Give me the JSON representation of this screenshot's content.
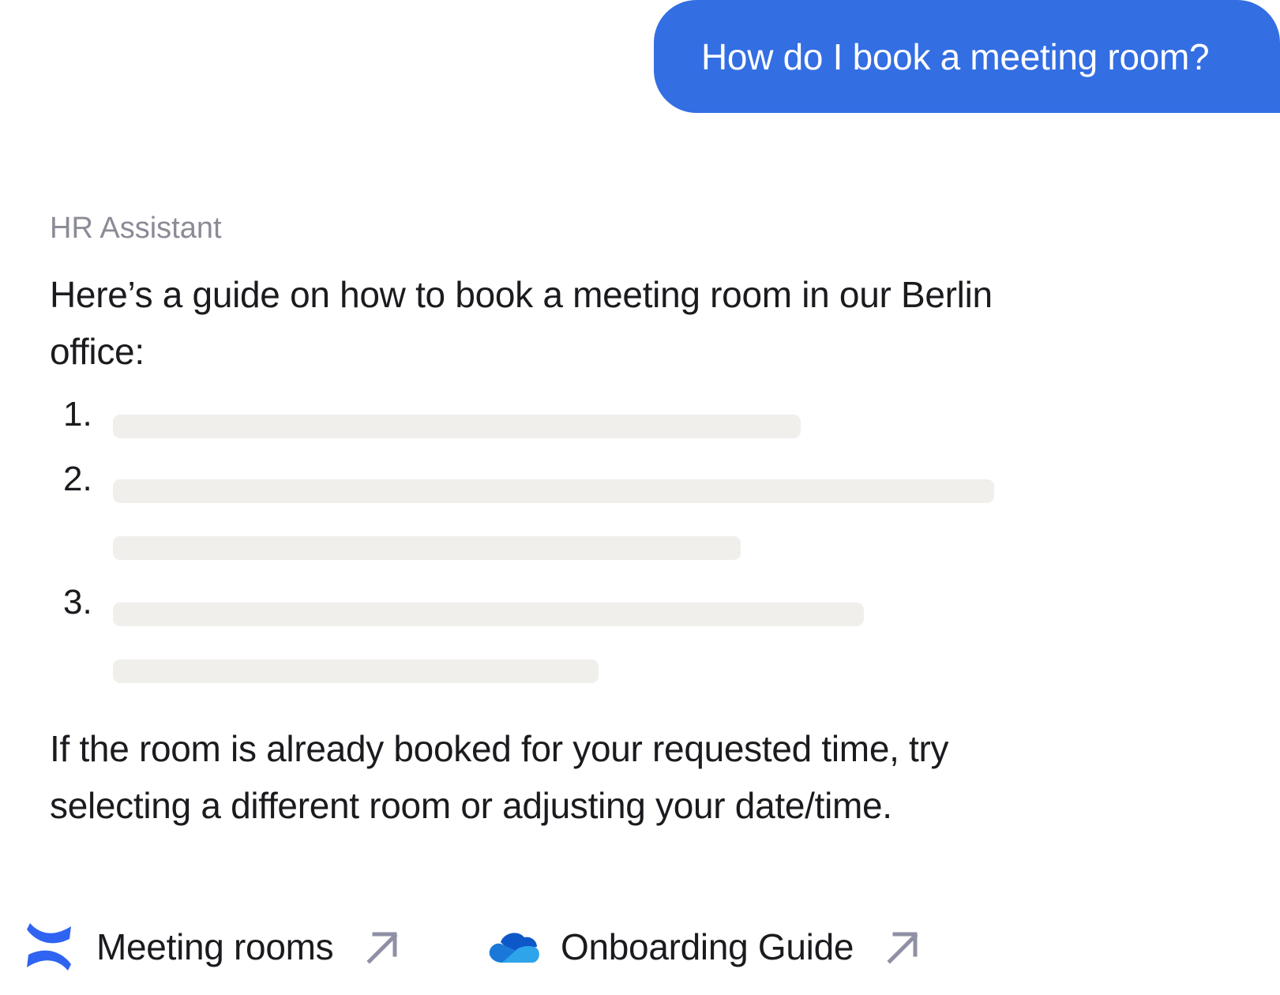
{
  "user_message": {
    "text": "How do I book a meeting room?"
  },
  "assistant": {
    "name": "HR Assistant",
    "intro": "Here’s a guide on how to book a meeting room in our Berlin office:",
    "steps": [
      {
        "number": "1."
      },
      {
        "number": "2."
      },
      {
        "number": "3."
      }
    ],
    "outro": "If the room is already booked for your requested time, try selecting a different room or adjusting your date/time."
  },
  "sources": [
    {
      "label": "Meeting rooms",
      "icon": "confluence-icon",
      "link_icon": "external-arrow-icon"
    },
    {
      "label": "Onboarding Guide",
      "icon": "onedrive-icon",
      "link_icon": "external-arrow-icon"
    }
  ],
  "colors": {
    "user_bubble": "#336ee2",
    "assistant_label": "#8b8b97",
    "skeleton": "#f0efec",
    "arrow": "#8f8fa5"
  }
}
